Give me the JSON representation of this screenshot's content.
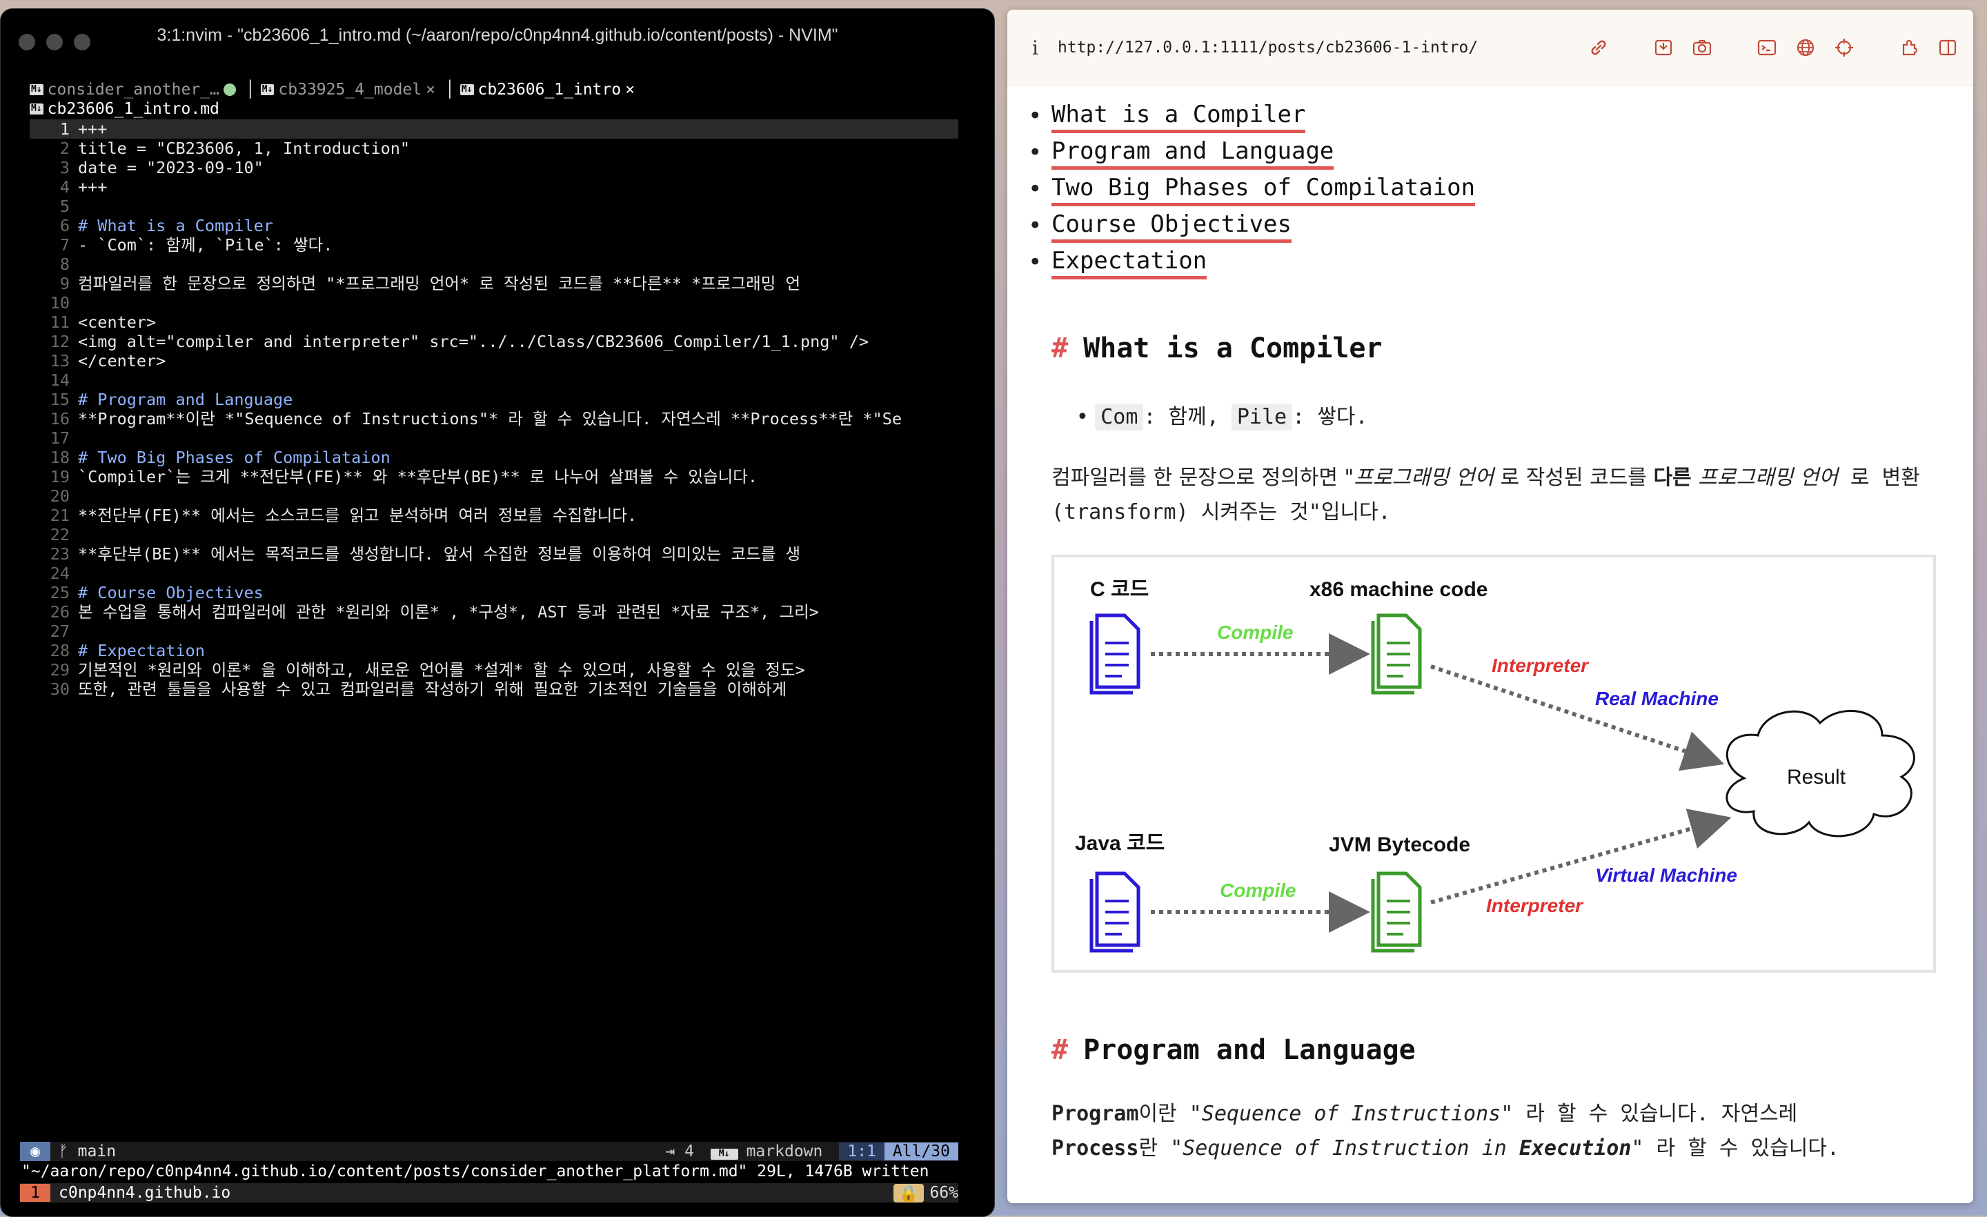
{
  "terminal": {
    "window_title": "3:1:nvim - \"cb23606_1_intro.md (~/aaron/repo/c0np4nn4.github.io/content/posts) - NVIM\"",
    "tabs": [
      {
        "label": "consider_another_…",
        "modified": true
      },
      {
        "label": "cb33925_4_model",
        "close": "×"
      },
      {
        "label": "cb23606_1_intro",
        "close": "×",
        "active": true
      }
    ],
    "winbar_file": "cb23606_1_intro.md",
    "lines": [
      {
        "n": "1",
        "text": "+++"
      },
      {
        "n": "2",
        "text": "title = \"CB23606, 1, Introduction\""
      },
      {
        "n": "3",
        "text": "date = \"2023-09-10\""
      },
      {
        "n": "4",
        "text": "+++"
      },
      {
        "n": "5",
        "text": ""
      },
      {
        "n": "6",
        "text": "# What is a Compiler"
      },
      {
        "n": "7",
        "text": "- `Com`: 함께, `Pile`: 쌓다."
      },
      {
        "n": "8",
        "text": ""
      },
      {
        "n": "9",
        "text": "컴파일러를 한 문장으로 정의하면 \"*프로그래밍 언어* 로 작성된 코드를 **다른** *프로그래밍 언"
      },
      {
        "n": "10",
        "text": ""
      },
      {
        "n": "11",
        "text": "<center>"
      },
      {
        "n": "12",
        "text": "<img alt=\"compiler and interpreter\" src=\"../../Class/CB23606_Compiler/1_1.png\" />"
      },
      {
        "n": "13",
        "text": "</center>"
      },
      {
        "n": "14",
        "text": ""
      },
      {
        "n": "15",
        "text": "# Program and Language"
      },
      {
        "n": "16",
        "text": "**Program**이란 *\"Sequence of Instructions\"* 라 할 수 있습니다. 자연스레 **Process**란 *\"Se"
      },
      {
        "n": "17",
        "text": ""
      },
      {
        "n": "18",
        "text": "# Two Big Phases of Compilataion"
      },
      {
        "n": "19",
        "text": "`Compiler`는 크게 **전단부(FE)** 와 **후단부(BE)** 로 나누어 살펴볼 수 있습니다."
      },
      {
        "n": "20",
        "text": ""
      },
      {
        "n": "21",
        "text": "**전단부(FE)** 에서는 소스코드를 읽고 분석하며 여러 정보를 수집합니다."
      },
      {
        "n": "22",
        "text": ""
      },
      {
        "n": "23",
        "text": "**후단부(BE)** 에서는 목적코드를 생성합니다. 앞서 수집한 정보를 이용하여 의미있는 코드를 생"
      },
      {
        "n": "24",
        "text": ""
      },
      {
        "n": "25",
        "text": "# Course Objectives"
      },
      {
        "n": "26",
        "text": "본 수업을 통해서 컴파일러에 관한 *원리와 이론* , *구성*, AST 등과 관련된 *자료 구조*, 그리>"
      },
      {
        "n": "27",
        "text": ""
      },
      {
        "n": "28",
        "text": "# Expectation"
      },
      {
        "n": "29",
        "text": "기본적인 *원리와 이론* 을 이해하고, 새로운 언어를 *설계* 할 수 있으며, 사용할 수 있을 정도>"
      },
      {
        "n": "30",
        "text": "또한, 관련 툴들을 사용할 수 있고 컴파일러를 작성하기 위해 필요한 기초적인 기술들을 이해하게"
      }
    ],
    "status": {
      "branch": "main",
      "indent": "⇥ 4",
      "filetype": "markdown",
      "position": "1:1",
      "scroll": "All/30"
    },
    "message": "\"~/aaron/repo/c0np4nn4.github.io/content/posts/consider_another_platform.md\" 29L, 1476B written",
    "tmux": {
      "window": "1",
      "session": "c0np4nn4.github.io",
      "zoom": "66%"
    }
  },
  "browser": {
    "url": "http://127.0.0.1:1111/posts/cb23606-1-intro/",
    "toc": [
      "What is a Compiler",
      "Program and Language",
      "Two Big Phases of Compilataion",
      "Course Objectives",
      "Expectation"
    ],
    "section1": {
      "title": "What is a Compiler",
      "bullet_com": "Com",
      "bullet_com_meaning": ": 함께, ",
      "bullet_pile": "Pile",
      "bullet_pile_meaning": ": 쌓다.",
      "p1": "컴파일러를 한 문장으로 정의하면 \"",
      "p1_i1": "프로그래밍 언어",
      "p1_2": " 로 작성된 코드를 ",
      "p1_b": "다른",
      "p1_3": " ",
      "p1_i2": "프로그래밍 언어",
      "p1_4": " 로 변환(transform) 시켜주는 것\"입니다."
    },
    "figure": {
      "c_code": "C 코드",
      "x86": "x86 machine code",
      "compile1": "Compile",
      "interp1": "Interpreter",
      "real_machine": "Real Machine",
      "result": "Result",
      "java_code": "Java 코드",
      "jvm": "JVM Bytecode",
      "compile2": "Compile",
      "virtual_machine": "Virtual Machine",
      "interp2": "Interpreter",
      "colors": {
        "doc_c": "#2a1ad8",
        "doc_out": "#3a9a2a",
        "compile": "#66dd44",
        "interp": "#e23030",
        "machine": "#2a1ad8"
      }
    },
    "section2": {
      "title": "Program and Language",
      "b1": "Program",
      "t1": "이란 ",
      "i1": "\"Sequence of Instructions\"",
      "t2": " 라 할 수 있습니다. 자연스레",
      "b2": "Process",
      "t3": "란 ",
      "i2a": "\"Sequence of Instruction in ",
      "i2b": "Execution",
      "i2c": "\"",
      "t4": " 라 할 수 있습니다."
    }
  }
}
